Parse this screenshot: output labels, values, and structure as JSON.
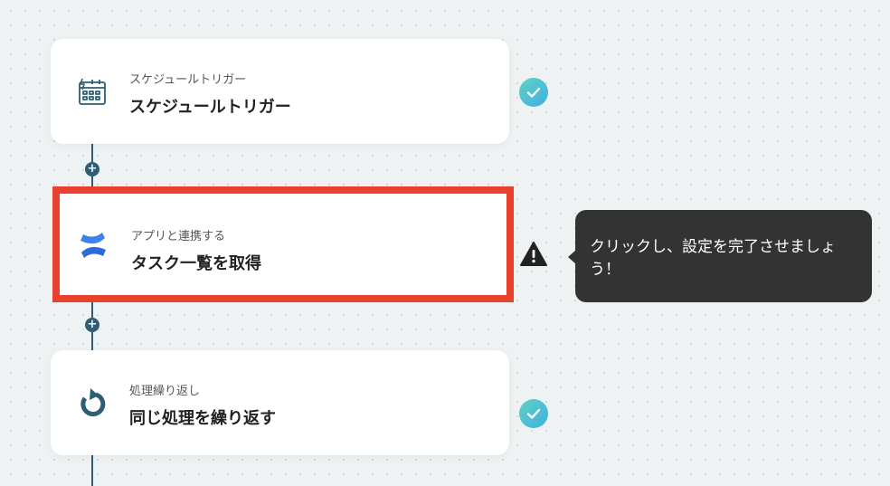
{
  "flow": {
    "steps": [
      {
        "subtitle": "スケジュールトリガー",
        "title": "スケジュールトリガー",
        "icon": "calendar-bolt-icon",
        "status": "complete"
      },
      {
        "subtitle": "アプリと連携する",
        "title": "タスク一覧を取得",
        "icon": "confluence-logo-icon",
        "status": "warning"
      },
      {
        "subtitle": "処理繰り返し",
        "title": "同じ処理を繰り返す",
        "icon": "loop-icon",
        "status": "complete"
      }
    ],
    "add_symbol": "+"
  },
  "tooltip": {
    "text": "クリックし、設定を完了させましょう！"
  },
  "colors": {
    "line": "#2f5d73",
    "highlight": "#e8412c",
    "check_start": "#5fd1c6",
    "check_end": "#3fb1df",
    "tooltip_bg": "#333333",
    "confluence_blue": "#2d6bd9"
  }
}
